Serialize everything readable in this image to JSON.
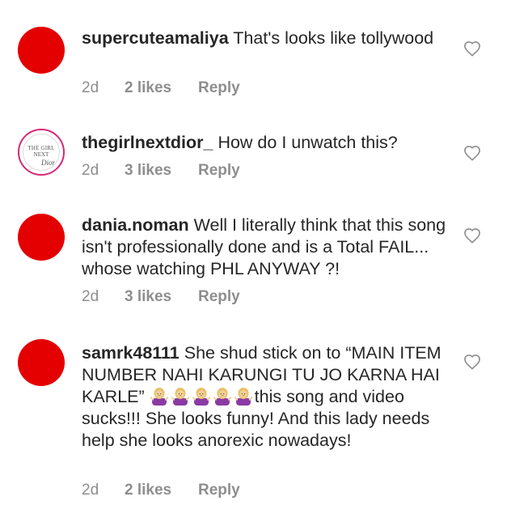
{
  "comments": [
    {
      "username": "supercuteamaliya",
      "text": " That's looks like tollywood",
      "time": "2d",
      "likes": "2 likes",
      "reply": "Reply",
      "avatar": "red-circle"
    },
    {
      "username": "thegirlnextdior_",
      "text": " How do I unwatch this?",
      "time": "2d",
      "likes": "3 likes",
      "reply": "Reply",
      "avatar_lines": [
        "THE GIRL",
        "NEXT",
        "Dior"
      ]
    },
    {
      "username": "dania.noman",
      "text": " Well I literally think that this song isn't professionally done and is a Total FAIL... whose watching PHL ANYWAY ?!",
      "time": "2d",
      "likes": "3 likes",
      "reply": "Reply",
      "avatar": "red-circle"
    },
    {
      "username": "samrk48111",
      "text_before": " She shud stick on to “MAIN ITEM NUMBER NAHI KARUNGI TU JO KARNA HAI KARLE” ",
      "emoji_count": 5,
      "emoji_icon": "person-shrugging-emoji",
      "text_after": "this song and video sucks!!! She looks funny! And  this lady needs help she looks anorexic nowadays!",
      "time": "2d",
      "likes": "2 likes",
      "reply": "Reply",
      "avatar": "red-circle"
    }
  ],
  "icons": {
    "like": "heart-outline-icon"
  },
  "colors": {
    "avatar_red": "#e40000",
    "meta_gray": "#8e8e8e",
    "text": "#262626"
  }
}
